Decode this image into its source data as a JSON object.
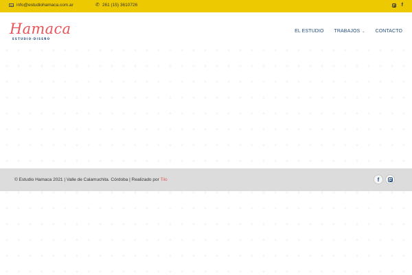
{
  "topbar": {
    "email": "info@estudiohamaca.com.ar",
    "email_icon": "envelope-icon",
    "phone": "261 (15) 3610726",
    "phone_icon": "phone-icon",
    "social": [
      "instagram-icon",
      "facebook-icon"
    ],
    "facebook_glyph": "f",
    "background": "#ecc900"
  },
  "header": {
    "logo_script": "Hamaca",
    "logo_sub": "ESTUDIO·DISEÑO",
    "nav": [
      {
        "label": "EL ESTUDIO"
      },
      {
        "label": "TRABAJOS"
      },
      {
        "label": "CONTACTO"
      }
    ],
    "brand_red": "#e8545a",
    "brand_blue": "#1f4b7a"
  },
  "footer": {
    "copyright": "© Estudio Hamaca 2021 | Valle de Calamuchita. Córdoba | Realizado por ",
    "credit_link": "Tilo",
    "social": [
      "facebook-icon",
      "instagram-icon"
    ],
    "facebook_glyph": "f",
    "background": "#dcdcdc"
  }
}
